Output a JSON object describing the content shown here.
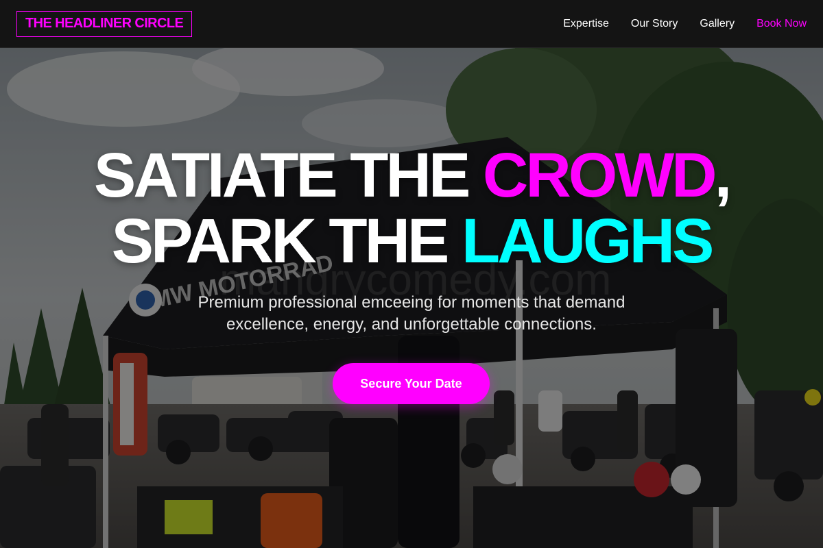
{
  "header": {
    "logo_text": "THE HEADLINER CIRCLE",
    "nav": [
      {
        "label": "Expertise"
      },
      {
        "label": "Our Story"
      },
      {
        "label": "Gallery"
      },
      {
        "label": "Book Now"
      }
    ]
  },
  "hero": {
    "headline_line1_part1": "SATIATE THE ",
    "headline_line1_highlight": "CROWD",
    "headline_line1_end": ",",
    "headline_line2_part1": "SPARK THE ",
    "headline_line2_highlight": "LAUGHS",
    "subtitle": "Premium professional emceeing for moments that demand excellence, energy, and unforgettable connections.",
    "cta_label": "Secure Your Date",
    "background_image": "outdoor-motorcycle-event-tent-photo",
    "tent_banner_text": "BMW MOTORRAD",
    "watermark_text": "mangrycomedy.com"
  },
  "colors": {
    "accent_magenta": "#ff00ff",
    "accent_cyan": "#00ffff",
    "header_bg": "#141414",
    "text_white": "#ffffff"
  }
}
